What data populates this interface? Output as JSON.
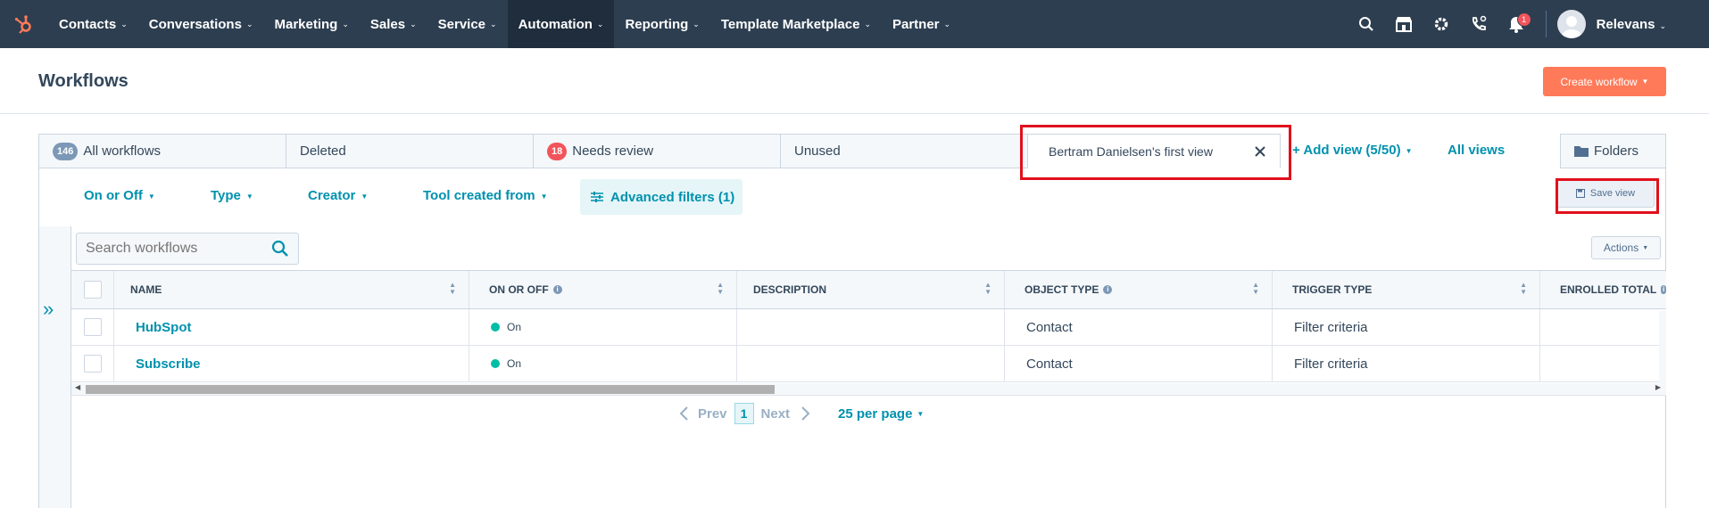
{
  "nav": {
    "items": [
      {
        "label": "Contacts"
      },
      {
        "label": "Conversations"
      },
      {
        "label": "Marketing"
      },
      {
        "label": "Sales"
      },
      {
        "label": "Service"
      },
      {
        "label": "Automation"
      },
      {
        "label": "Reporting"
      },
      {
        "label": "Template Marketplace"
      },
      {
        "label": "Partner"
      }
    ],
    "active": "Automation",
    "notification_count": "1",
    "account_name": "Relevans"
  },
  "header": {
    "title": "Workflows",
    "create_button": "Create workflow"
  },
  "tabs": [
    {
      "count": "146",
      "label": "All workflows"
    },
    {
      "label": "Deleted"
    },
    {
      "count": "18",
      "label": "Needs review"
    },
    {
      "label": "Unused"
    },
    {
      "label": "Bertram Danielsen's first view"
    }
  ],
  "add_view": "+ Add view (5/50)",
  "all_views": "All views",
  "folders": "Folders",
  "filters": {
    "on_off": "On or Off",
    "type": "Type",
    "creator": "Creator",
    "tool_created_from": "Tool created from",
    "advanced": "Advanced filters (1)",
    "save_view": "Save view"
  },
  "search": {
    "placeholder": "Search workflows"
  },
  "actions": "Actions",
  "columns": [
    "NAME",
    "ON OR OFF",
    "DESCRIPTION",
    "OBJECT TYPE",
    "TRIGGER TYPE",
    "ENROLLED TOTAL"
  ],
  "rows": [
    {
      "name": "HubSpot",
      "status": "On",
      "description": "",
      "object_type": "Contact",
      "trigger_type": "Filter criteria"
    },
    {
      "name": "Subscribe",
      "status": "On",
      "description": "",
      "object_type": "Contact",
      "trigger_type": "Filter criteria"
    }
  ],
  "pagination": {
    "prev": "Prev",
    "page": "1",
    "next": "Next",
    "per_page": "25 per page"
  },
  "colors": {
    "nav_bg": "#2d3e50",
    "accent": "#0091ae",
    "cta": "#ff7a59",
    "highlight_box": "#e0101c"
  }
}
